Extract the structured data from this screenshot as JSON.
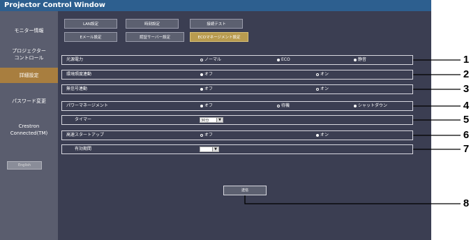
{
  "window": {
    "title": "Projector Control Window"
  },
  "sidebar": {
    "items": [
      {
        "label_line1": "モニター情報",
        "label_line2": ""
      },
      {
        "label_line1": "プロジェクター",
        "label_line2": "コントロール"
      },
      {
        "label_line1": "詳細設定",
        "label_line2": ""
      },
      {
        "label_line1": "パスワード変更",
        "label_line2": ""
      },
      {
        "label_line1": "Crestron",
        "label_line2": "Connected(TM)"
      }
    ],
    "active_index": 2,
    "english_button": "English"
  },
  "tabs": {
    "row1": [
      "LAN設定",
      "時刻設定",
      "接続テスト"
    ],
    "row2": [
      "Eメール設定",
      "認証サーバー設定",
      "ECOマネージメント設定"
    ],
    "active": "ECOマネージメント設定"
  },
  "settings": {
    "light_power": {
      "label": "光源電力",
      "options": [
        "ノーマル",
        "ECO",
        "静音"
      ],
      "selected": [
        "ECO",
        "静音"
      ]
    },
    "ambient_light": {
      "label": "環境照度連動",
      "options": [
        "オフ",
        "オン"
      ],
      "selected": [
        "オフ"
      ]
    },
    "no_signal": {
      "label": "無信号連動",
      "options": [
        "オフ",
        "オン"
      ],
      "selected": [
        "オフ"
      ]
    },
    "power_management": {
      "label": "パワーマネージメント",
      "options": [
        "オフ",
        "待機",
        "シャットダウン"
      ],
      "selected": [
        "オフ",
        "シャットダウン"
      ]
    },
    "timer": {
      "label": "タイマー",
      "value": "30分"
    },
    "quick_startup": {
      "label": "高速スタートアップ",
      "options": [
        "オフ",
        "オン"
      ],
      "selected": [
        "オン"
      ]
    },
    "valid_period": {
      "label": "有効期間",
      "value": ""
    }
  },
  "submit_label": "送信",
  "callouts": [
    "1",
    "2",
    "3",
    "4",
    "5",
    "6",
    "7",
    "8"
  ],
  "colors": {
    "background": "#3b3e52",
    "sidebar": "#5a5d6e",
    "active_item": "#a87e3f",
    "active_tab": "#b89b4f",
    "titlebar": "#2d5f8f"
  }
}
